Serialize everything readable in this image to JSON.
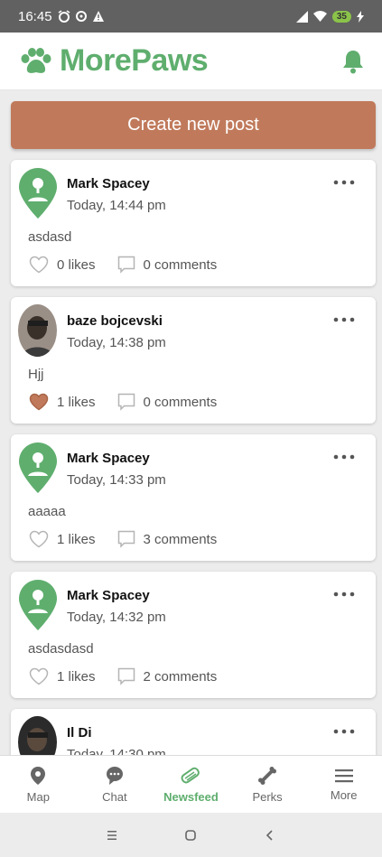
{
  "status_bar": {
    "time": "16:45",
    "battery": "35"
  },
  "app": {
    "name": "MorePaws"
  },
  "create_button": {
    "label": "Create new post"
  },
  "posts": [
    {
      "author": "Mark Spacey",
      "time": "Today, 14:44 pm",
      "body": "asdasd",
      "likes": "0 likes",
      "comments": "0 comments",
      "liked": false,
      "avatar": "default"
    },
    {
      "author": "baze bojcevski",
      "time": "Today, 14:38 pm",
      "body": "Hjj",
      "likes": "1 likes",
      "comments": "0 comments",
      "liked": true,
      "avatar": "photo"
    },
    {
      "author": "Mark Spacey",
      "time": "Today, 14:33 pm",
      "body": "aaaaa",
      "likes": "1 likes",
      "comments": "3 comments",
      "liked": false,
      "avatar": "default"
    },
    {
      "author": "Mark Spacey",
      "time": "Today, 14:32 pm",
      "body": "asdasdasd",
      "likes": "1 likes",
      "comments": "2 comments",
      "liked": false,
      "avatar": "default"
    },
    {
      "author": "Il Di",
      "time": "Today, 14:30 pm",
      "body": "",
      "likes": "",
      "comments": "",
      "liked": false,
      "avatar": "photo"
    }
  ],
  "bottom_nav": {
    "items": [
      {
        "label": "Map",
        "icon": "map-pin-icon"
      },
      {
        "label": "Chat",
        "icon": "chat-bubble-icon"
      },
      {
        "label": "Newsfeed",
        "icon": "newspaper-icon",
        "active": true
      },
      {
        "label": "Perks",
        "icon": "bone-icon"
      },
      {
        "label": "More",
        "icon": "menu-icon"
      }
    ]
  },
  "colors": {
    "brand_green": "#5fae6e",
    "accent_brown": "#c07a5b"
  }
}
